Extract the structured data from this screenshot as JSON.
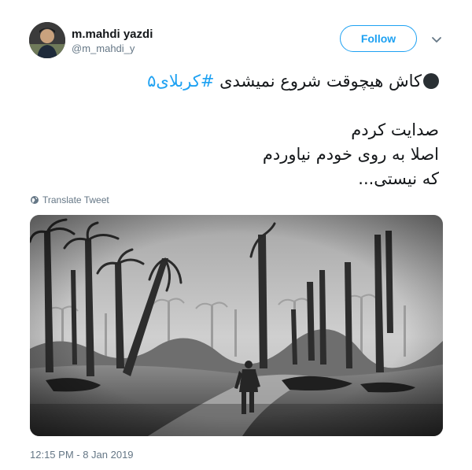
{
  "user": {
    "display_name": "m.mahdi yazdi",
    "handle": "@m_mahdi_y"
  },
  "follow_label": "Follow",
  "tweet": {
    "line1_text": "کاش هیچوقت شروع نمیشدی ",
    "line1_hashtag": "#کربلای۵",
    "line2": "صدایت کردم",
    "line3": "اصلا به روی خودم نیاوردم",
    "line4": "که نیستی..."
  },
  "translate_label": "Translate Tweet",
  "timestamp": "12:15 PM - 8 Jan 2019",
  "icons": {
    "menu": "chevron-down-icon",
    "translate": "globe-icon",
    "bullet": "black-circle-emoji"
  },
  "colors": {
    "accent": "#1da1f2",
    "secondary_text": "#657786",
    "primary_text": "#14171a"
  }
}
